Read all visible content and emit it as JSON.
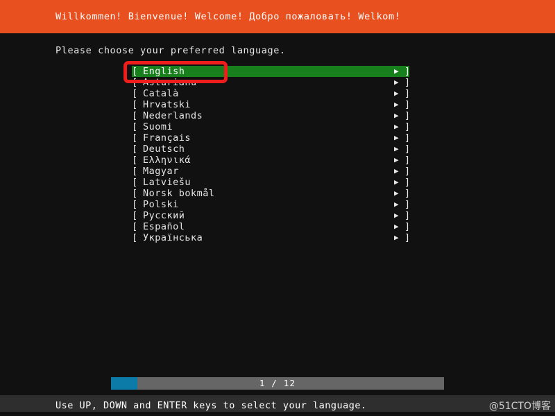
{
  "header": {
    "welcome_text": "Willkommen! Bienvenue! Welcome! Добро пожаловать! Welkom!",
    "background_color": "#e8501f"
  },
  "prompt": {
    "text": "Please choose your preferred language."
  },
  "language_list": {
    "bracket_open": "[",
    "bracket_close": "]",
    "arrow_icon": "▶",
    "selected_index": 0,
    "highlight_color": "#17801d",
    "items": [
      {
        "label": "English"
      },
      {
        "label": "Asturianu"
      },
      {
        "label": "Català"
      },
      {
        "label": "Hrvatski"
      },
      {
        "label": "Nederlands"
      },
      {
        "label": "Suomi"
      },
      {
        "label": "Français"
      },
      {
        "label": "Deutsch"
      },
      {
        "label": "Ελληνικά"
      },
      {
        "label": "Magyar"
      },
      {
        "label": "Latviešu"
      },
      {
        "label": "Norsk bokmål"
      },
      {
        "label": "Polski"
      },
      {
        "label": "Русский"
      },
      {
        "label": "Español"
      },
      {
        "label": "Українська"
      }
    ]
  },
  "annotation": {
    "color": "#f01d1d",
    "target": "English"
  },
  "progress": {
    "label": "1 / 12",
    "current": 1,
    "total": 12,
    "percent": 8,
    "fill_color": "#0d7ba8",
    "track_color": "#666666"
  },
  "footer": {
    "hint": "Use UP, DOWN and ENTER keys to select your language.",
    "watermark": "@51CTO博客"
  }
}
